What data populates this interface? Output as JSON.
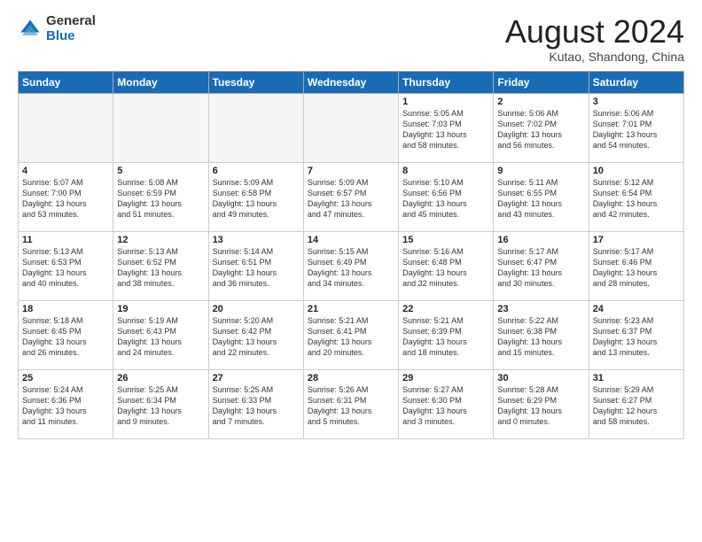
{
  "logo": {
    "general": "General",
    "blue": "Blue"
  },
  "title": "August 2024",
  "location": "Kutao, Shandong, China",
  "weekdays": [
    "Sunday",
    "Monday",
    "Tuesday",
    "Wednesday",
    "Thursday",
    "Friday",
    "Saturday"
  ],
  "weeks": [
    [
      {
        "day": "",
        "text": ""
      },
      {
        "day": "",
        "text": ""
      },
      {
        "day": "",
        "text": ""
      },
      {
        "day": "",
        "text": ""
      },
      {
        "day": "1",
        "text": "Sunrise: 5:05 AM\nSunset: 7:03 PM\nDaylight: 13 hours\nand 58 minutes."
      },
      {
        "day": "2",
        "text": "Sunrise: 5:06 AM\nSunset: 7:02 PM\nDaylight: 13 hours\nand 56 minutes."
      },
      {
        "day": "3",
        "text": "Sunrise: 5:06 AM\nSunset: 7:01 PM\nDaylight: 13 hours\nand 54 minutes."
      }
    ],
    [
      {
        "day": "4",
        "text": "Sunrise: 5:07 AM\nSunset: 7:00 PM\nDaylight: 13 hours\nand 53 minutes."
      },
      {
        "day": "5",
        "text": "Sunrise: 5:08 AM\nSunset: 6:59 PM\nDaylight: 13 hours\nand 51 minutes."
      },
      {
        "day": "6",
        "text": "Sunrise: 5:09 AM\nSunset: 6:58 PM\nDaylight: 13 hours\nand 49 minutes."
      },
      {
        "day": "7",
        "text": "Sunrise: 5:09 AM\nSunset: 6:57 PM\nDaylight: 13 hours\nand 47 minutes."
      },
      {
        "day": "8",
        "text": "Sunrise: 5:10 AM\nSunset: 6:56 PM\nDaylight: 13 hours\nand 45 minutes."
      },
      {
        "day": "9",
        "text": "Sunrise: 5:11 AM\nSunset: 6:55 PM\nDaylight: 13 hours\nand 43 minutes."
      },
      {
        "day": "10",
        "text": "Sunrise: 5:12 AM\nSunset: 6:54 PM\nDaylight: 13 hours\nand 42 minutes."
      }
    ],
    [
      {
        "day": "11",
        "text": "Sunrise: 5:13 AM\nSunset: 6:53 PM\nDaylight: 13 hours\nand 40 minutes."
      },
      {
        "day": "12",
        "text": "Sunrise: 5:13 AM\nSunset: 6:52 PM\nDaylight: 13 hours\nand 38 minutes."
      },
      {
        "day": "13",
        "text": "Sunrise: 5:14 AM\nSunset: 6:51 PM\nDaylight: 13 hours\nand 36 minutes."
      },
      {
        "day": "14",
        "text": "Sunrise: 5:15 AM\nSunset: 6:49 PM\nDaylight: 13 hours\nand 34 minutes."
      },
      {
        "day": "15",
        "text": "Sunrise: 5:16 AM\nSunset: 6:48 PM\nDaylight: 13 hours\nand 32 minutes."
      },
      {
        "day": "16",
        "text": "Sunrise: 5:17 AM\nSunset: 6:47 PM\nDaylight: 13 hours\nand 30 minutes."
      },
      {
        "day": "17",
        "text": "Sunrise: 5:17 AM\nSunset: 6:46 PM\nDaylight: 13 hours\nand 28 minutes."
      }
    ],
    [
      {
        "day": "18",
        "text": "Sunrise: 5:18 AM\nSunset: 6:45 PM\nDaylight: 13 hours\nand 26 minutes."
      },
      {
        "day": "19",
        "text": "Sunrise: 5:19 AM\nSunset: 6:43 PM\nDaylight: 13 hours\nand 24 minutes."
      },
      {
        "day": "20",
        "text": "Sunrise: 5:20 AM\nSunset: 6:42 PM\nDaylight: 13 hours\nand 22 minutes."
      },
      {
        "day": "21",
        "text": "Sunrise: 5:21 AM\nSunset: 6:41 PM\nDaylight: 13 hours\nand 20 minutes."
      },
      {
        "day": "22",
        "text": "Sunrise: 5:21 AM\nSunset: 6:39 PM\nDaylight: 13 hours\nand 18 minutes."
      },
      {
        "day": "23",
        "text": "Sunrise: 5:22 AM\nSunset: 6:38 PM\nDaylight: 13 hours\nand 15 minutes."
      },
      {
        "day": "24",
        "text": "Sunrise: 5:23 AM\nSunset: 6:37 PM\nDaylight: 13 hours\nand 13 minutes."
      }
    ],
    [
      {
        "day": "25",
        "text": "Sunrise: 5:24 AM\nSunset: 6:36 PM\nDaylight: 13 hours\nand 11 minutes."
      },
      {
        "day": "26",
        "text": "Sunrise: 5:25 AM\nSunset: 6:34 PM\nDaylight: 13 hours\nand 9 minutes."
      },
      {
        "day": "27",
        "text": "Sunrise: 5:25 AM\nSunset: 6:33 PM\nDaylight: 13 hours\nand 7 minutes."
      },
      {
        "day": "28",
        "text": "Sunrise: 5:26 AM\nSunset: 6:31 PM\nDaylight: 13 hours\nand 5 minutes."
      },
      {
        "day": "29",
        "text": "Sunrise: 5:27 AM\nSunset: 6:30 PM\nDaylight: 13 hours\nand 3 minutes."
      },
      {
        "day": "30",
        "text": "Sunrise: 5:28 AM\nSunset: 6:29 PM\nDaylight: 13 hours\nand 0 minutes."
      },
      {
        "day": "31",
        "text": "Sunrise: 5:29 AM\nSunset: 6:27 PM\nDaylight: 12 hours\nand 58 minutes."
      }
    ]
  ]
}
